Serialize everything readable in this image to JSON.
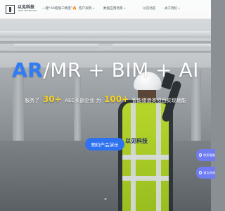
{
  "brand": {
    "name_cn": "以见科技",
    "name_en": "YIJIAN TECHNOLOGY"
  },
  "nav": {
    "items": [
      {
        "label": "一键“AR看施工精度”",
        "has_flame": true,
        "flame": "🔥",
        "has_caret": false
      },
      {
        "label": "客户案例",
        "has_caret": true
      },
      {
        "label": "数据应用场景",
        "has_caret": true
      },
      {
        "label": "以见动态",
        "has_caret": false
      },
      {
        "label": "关于我们",
        "has_caret": true
      }
    ]
  },
  "hero": {
    "headline_accent": "AR",
    "headline_rest": "/MR + BIM + AI",
    "sub_prefix": "服务了",
    "sub_num1": "30+",
    "sub_mid": "AEC头部企业 为",
    "sub_num2": "100+",
    "sub_suffix": "智能建造类项目实现赋能",
    "cta_label": "预约产品演示",
    "brand_tag": "以见科技"
  },
  "side": {
    "chips": [
      {
        "label": "联系客服",
        "icon": "headset-icon"
      },
      {
        "label": "留言咨询",
        "icon": "message-icon"
      }
    ]
  },
  "colors": {
    "accent_blue": "#2f7cf6",
    "highlight_yellow": "#f7d323",
    "cta_blue": "#2f72f0",
    "side_chip": "#6f7cf2"
  }
}
